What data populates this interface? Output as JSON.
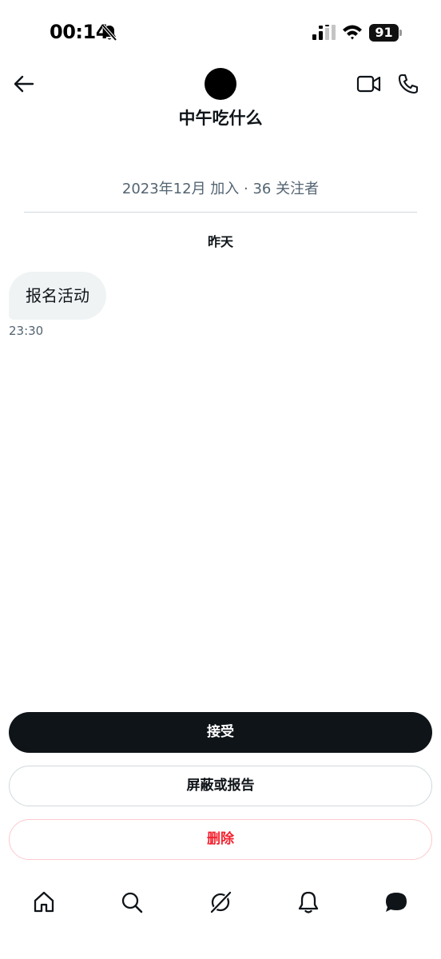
{
  "status_bar": {
    "time": "00:14",
    "battery_level": "91",
    "icons": [
      "bell-slash-icon",
      "signal-icon",
      "wifi-icon",
      "battery-icon"
    ]
  },
  "header": {
    "title": "中午吃什么",
    "icons": [
      "back-arrow-icon",
      "video-camera-icon",
      "phone-icon"
    ]
  },
  "profile": {
    "meta": "2023年12月 加入 · 36 关注者"
  },
  "conversation": {
    "day_label": "昨天",
    "messages": [
      {
        "text": "报名活动",
        "time": "23:30"
      }
    ]
  },
  "actions": {
    "accept_label": "接受",
    "block_report_label": "屏蔽或报告",
    "delete_label": "删除"
  },
  "colors": {
    "accept_bg": "#0f1419",
    "delete_text": "#f4212e",
    "bubble_bg": "#eff3f4",
    "meta_text": "#536471"
  },
  "bottom_nav": {
    "items": [
      "home-icon",
      "search-icon",
      "grok-icon",
      "notifications-icon",
      "messages-icon"
    ]
  }
}
